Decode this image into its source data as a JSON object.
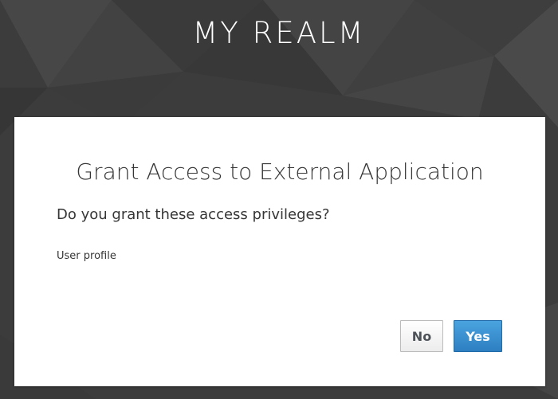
{
  "realm": {
    "title": "MY REALM"
  },
  "consent": {
    "title": "Grant Access to External Application",
    "question": "Do you grant these access privileges?",
    "scopes": [
      "User profile"
    ],
    "no_label": "No",
    "yes_label": "Yes"
  },
  "colors": {
    "background": "#3f3f3f",
    "card": "#ffffff",
    "text": "#363636",
    "primary_button": "#3a8fd0",
    "secondary_button_border": "#bbbbbb"
  }
}
